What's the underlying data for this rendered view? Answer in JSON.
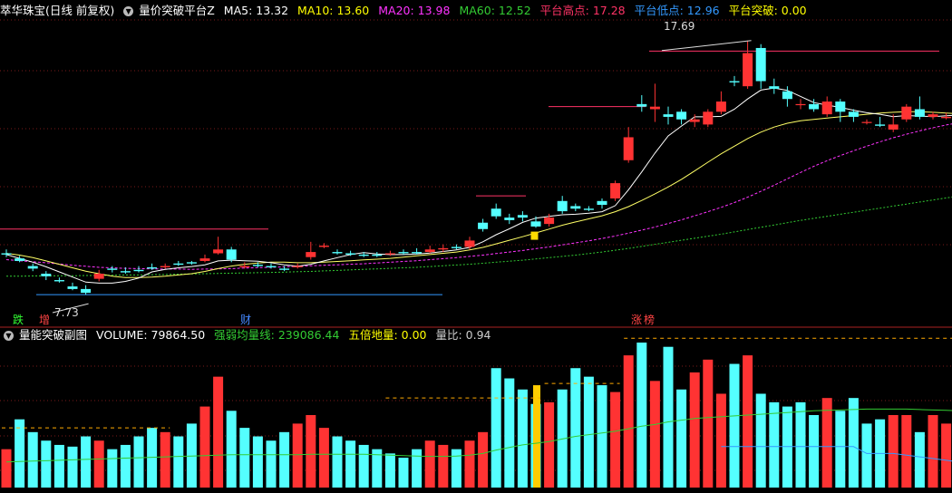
{
  "main_header": {
    "stock": "萃华珠宝(日线 前复权)",
    "indicator": "量价突破平台Z",
    "ma5": "MA5: 13.32",
    "ma10": "MA10: 13.60",
    "ma20": "MA20: 13.98",
    "ma60": "MA60: 12.52",
    "plat_high": "平台高点: 17.28",
    "plat_low": "平台低点: 12.96",
    "breakout": "平台突破: 0.00",
    "colors": {
      "ma5": "#ffffff",
      "ma10": "#ffff00",
      "ma20": "#ff33ff",
      "ma60": "#33cc33",
      "plat_high": "#ff3366",
      "plat_low": "#3399ff",
      "breakout": "#ffff00"
    }
  },
  "sub_header": {
    "indicator": "量能突破副图",
    "volume": "VOLUME: 79864.50",
    "strong_weak": "强弱均量线: 239086.44",
    "five_times": "五倍地量: 0.00",
    "ratio": "量比: 0.94"
  },
  "markers": {
    "max_label": "17.69",
    "min_label": "7.73",
    "die": "跌",
    "zeng": "增",
    "cai": "财",
    "zhang": "涨",
    "bang": "榜"
  },
  "chart_data": [
    {
      "type": "candlestick",
      "ylim": [
        7.2,
        18.5
      ],
      "grid": true,
      "platform_high_line": 17.28,
      "platform_low_line": 7.73,
      "early_platform_line": 10.3,
      "max_price": 17.69,
      "min_price": 7.73,
      "candles": [
        [
          9.35,
          9.3,
          9.5,
          9.2
        ],
        [
          9.15,
          9.05,
          9.25,
          9.0
        ],
        [
          8.85,
          8.75,
          8.95,
          8.65
        ],
        [
          8.55,
          8.45,
          8.65,
          8.3
        ],
        [
          8.3,
          8.25,
          8.4,
          8.2
        ],
        [
          8.05,
          7.95,
          8.2,
          7.9
        ],
        [
          7.95,
          7.8,
          8.1,
          7.73
        ],
        [
          8.35,
          8.55,
          8.7,
          8.25
        ],
        [
          8.75,
          8.7,
          8.85,
          8.6
        ],
        [
          8.65,
          8.6,
          8.8,
          8.55
        ],
        [
          8.7,
          8.65,
          8.85,
          8.6
        ],
        [
          8.8,
          8.75,
          8.95,
          8.7
        ],
        [
          8.8,
          8.85,
          8.95,
          8.75
        ],
        [
          8.95,
          8.9,
          9.05,
          8.85
        ],
        [
          9.0,
          8.95,
          9.05,
          8.9
        ],
        [
          9.05,
          9.15,
          9.3,
          9.0
        ],
        [
          9.35,
          9.5,
          10.0,
          9.3
        ],
        [
          9.5,
          9.1,
          9.6,
          9.0
        ],
        [
          8.8,
          8.85,
          9.0,
          8.75
        ],
        [
          8.9,
          8.85,
          9.0,
          8.8
        ],
        [
          8.85,
          8.8,
          8.95,
          8.75
        ],
        [
          8.75,
          8.7,
          8.85,
          8.65
        ],
        [
          8.8,
          8.85,
          8.95,
          8.75
        ],
        [
          9.2,
          9.4,
          9.8,
          9.1
        ],
        [
          9.6,
          9.65,
          9.75,
          9.55
        ],
        [
          9.4,
          9.35,
          9.5,
          9.3
        ],
        [
          9.35,
          9.3,
          9.45,
          9.25
        ],
        [
          9.3,
          9.25,
          9.4,
          9.2
        ],
        [
          9.3,
          9.25,
          9.4,
          9.2
        ],
        [
          9.35,
          9.35,
          9.45,
          9.25
        ],
        [
          9.4,
          9.35,
          9.5,
          9.3
        ],
        [
          9.4,
          9.35,
          9.55,
          9.3
        ],
        [
          9.4,
          9.5,
          9.65,
          9.35
        ],
        [
          9.5,
          9.55,
          9.7,
          9.4
        ],
        [
          9.6,
          9.55,
          9.7,
          9.5
        ],
        [
          9.6,
          9.85,
          10.0,
          9.5
        ],
        [
          10.55,
          10.3,
          10.7,
          10.2
        ],
        [
          11.1,
          10.8,
          11.3,
          10.7
        ],
        [
          10.75,
          10.65,
          10.9,
          10.5
        ],
        [
          10.85,
          10.75,
          11.0,
          10.6
        ],
        [
          10.6,
          10.4,
          10.8,
          10.35
        ],
        [
          10.5,
          10.75,
          10.9,
          10.4
        ],
        [
          11.4,
          11.0,
          11.6,
          10.9
        ],
        [
          11.2,
          11.1,
          11.3,
          11.0
        ],
        [
          11.1,
          11.05,
          11.2,
          11.0
        ],
        [
          11.4,
          11.25,
          11.5,
          11.1
        ],
        [
          11.5,
          12.1,
          12.2,
          11.4
        ],
        [
          13.0,
          13.9,
          14.3,
          12.9
        ],
        [
          15.2,
          15.1,
          15.55,
          14.9
        ],
        [
          15.0,
          15.1,
          16.0,
          14.5
        ],
        [
          14.8,
          14.7,
          15.1,
          14.4
        ],
        [
          14.9,
          14.6,
          15.0,
          14.4
        ],
        [
          14.5,
          14.6,
          14.8,
          14.3
        ],
        [
          14.4,
          14.9,
          15.0,
          14.3
        ],
        [
          14.9,
          15.3,
          15.7,
          14.8
        ],
        [
          16.1,
          16.05,
          16.3,
          15.9
        ],
        [
          15.9,
          17.2,
          17.69,
          15.8
        ],
        [
          17.4,
          16.1,
          17.55,
          15.8
        ],
        [
          15.9,
          15.8,
          16.2,
          15.6
        ],
        [
          15.7,
          15.4,
          15.9,
          15.1
        ],
        [
          15.2,
          15.2,
          15.4,
          15.0
        ],
        [
          15.2,
          15.0,
          15.4,
          14.9
        ],
        [
          14.8,
          15.3,
          15.5,
          14.7
        ],
        [
          15.3,
          14.9,
          15.4,
          14.5
        ],
        [
          14.9,
          14.7,
          15.0,
          14.5
        ],
        [
          14.5,
          14.5,
          14.6,
          14.4
        ],
        [
          14.4,
          14.35,
          14.7,
          14.3
        ],
        [
          14.2,
          14.4,
          14.8,
          14.1
        ],
        [
          14.6,
          15.1,
          15.2,
          14.5
        ],
        [
          15.0,
          14.7,
          15.5,
          14.6
        ],
        [
          14.7,
          14.8,
          14.9,
          14.6
        ],
        [
          14.65,
          14.7,
          14.85,
          14.6
        ],
        [
          14.75,
          14.6,
          14.8,
          14.5
        ],
        [
          14.6,
          14.3,
          14.7,
          14.2
        ],
        [
          14.2,
          14.25,
          14.35,
          14.1
        ],
        [
          14.3,
          14.4,
          14.5,
          14.2
        ],
        [
          14.25,
          14.15,
          14.3,
          14.1
        ],
        [
          14.15,
          14.05,
          14.2,
          13.95
        ],
        [
          13.95,
          14.0,
          14.05,
          13.9
        ],
        [
          14.0,
          14.05,
          14.1,
          13.95
        ],
        [
          14.05,
          13.6,
          14.1,
          13.55
        ],
        [
          13.4,
          13.65,
          13.75,
          13.35
        ],
        [
          13.6,
          13.55,
          13.65,
          13.5
        ]
      ],
      "ma5": [
        9.3,
        9.15,
        9.0,
        8.82,
        8.62,
        8.42,
        8.22,
        8.18,
        8.18,
        8.25,
        8.38,
        8.62,
        8.72,
        8.78,
        8.83,
        8.9,
        9.05,
        9.08,
        9.06,
        9.04,
        8.98,
        8.9,
        8.84,
        8.92,
        9.05,
        9.18,
        9.3,
        9.38,
        9.32,
        9.3,
        9.3,
        9.32,
        9.36,
        9.42,
        9.48,
        9.58,
        9.8,
        10.08,
        10.31,
        10.56,
        10.73,
        10.8,
        10.86,
        10.88,
        10.92,
        10.98,
        11.22,
        11.84,
        12.54,
        13.28,
        13.95,
        14.34,
        14.7,
        14.7,
        14.72,
        15.0,
        15.4,
        15.75,
        15.83,
        15.74,
        15.5,
        15.26,
        15.16,
        15.07,
        14.96,
        14.86,
        14.8,
        14.71,
        14.75,
        14.73,
        14.71,
        14.74,
        14.78,
        14.69,
        14.56,
        14.43,
        14.32,
        14.25,
        14.16,
        14.12,
        14.03,
        13.88,
        13.76
      ],
      "ma10": [
        9.35,
        9.28,
        9.18,
        9.05,
        8.92,
        8.78,
        8.65,
        8.55,
        8.45,
        8.4,
        8.4,
        8.42,
        8.45,
        8.5,
        8.55,
        8.64,
        8.75,
        8.85,
        8.92,
        8.97,
        9.0,
        9.0,
        8.98,
        8.98,
        9.0,
        9.03,
        9.06,
        9.09,
        9.12,
        9.15,
        9.2,
        9.25,
        9.3,
        9.35,
        9.4,
        9.48,
        9.58,
        9.72,
        9.86,
        10.0,
        10.15,
        10.3,
        10.45,
        10.58,
        10.7,
        10.82,
        10.98,
        11.18,
        11.42,
        11.68,
        11.95,
        12.25,
        12.58,
        12.92,
        13.25,
        13.55,
        13.85,
        14.1,
        14.3,
        14.45,
        14.55,
        14.6,
        14.65,
        14.7,
        14.75,
        14.8,
        14.85,
        14.88,
        14.9,
        14.9,
        14.88,
        14.85,
        14.82,
        14.79,
        14.76,
        14.7,
        14.64,
        14.58,
        14.5,
        14.42,
        14.33,
        14.25,
        14.16
      ],
      "ma20": [
        9.1,
        9.06,
        9.02,
        8.98,
        8.93,
        8.88,
        8.84,
        8.8,
        8.78,
        8.76,
        8.75,
        8.74,
        8.73,
        8.73,
        8.72,
        8.73,
        8.74,
        8.75,
        8.77,
        8.79,
        8.8,
        8.82,
        8.84,
        8.86,
        8.88,
        8.9,
        8.92,
        8.94,
        8.97,
        9.0,
        9.03,
        9.06,
        9.1,
        9.14,
        9.18,
        9.23,
        9.28,
        9.34,
        9.4,
        9.46,
        9.53,
        9.6,
        9.68,
        9.76,
        9.84,
        9.93,
        10.03,
        10.14,
        10.26,
        10.38,
        10.52,
        10.66,
        10.82,
        10.98,
        11.15,
        11.34,
        11.55,
        11.78,
        12.02,
        12.27,
        12.52,
        12.76,
        12.98,
        13.18,
        13.37,
        13.55,
        13.72,
        13.88,
        14.02,
        14.15,
        14.27,
        14.38,
        14.47,
        14.55,
        14.62,
        14.67,
        14.7,
        14.71,
        14.7,
        14.66,
        14.6,
        14.52,
        14.42
      ],
      "ma60": [
        8.45,
        8.45,
        8.46,
        8.46,
        8.47,
        8.47,
        8.48,
        8.48,
        8.49,
        8.5,
        8.5,
        8.51,
        8.52,
        8.53,
        8.54,
        8.55,
        8.56,
        8.57,
        8.58,
        8.59,
        8.6,
        8.61,
        8.63,
        8.64,
        8.66,
        8.68,
        8.7,
        8.72,
        8.74,
        8.76,
        8.78,
        8.8,
        8.83,
        8.86,
        8.89,
        8.92,
        8.96,
        9.0,
        9.04,
        9.08,
        9.13,
        9.18,
        9.23,
        9.28,
        9.34,
        9.4,
        9.47,
        9.54,
        9.62,
        9.7,
        9.78,
        9.86,
        9.94,
        10.02,
        10.1,
        10.19,
        10.28,
        10.37,
        10.46,
        10.55,
        10.64,
        10.72,
        10.8,
        10.88,
        10.96,
        11.04,
        11.12,
        11.2,
        11.28,
        11.36,
        11.44,
        11.52,
        11.6,
        11.68,
        11.76,
        11.84,
        11.92,
        12.0,
        12.08,
        12.16,
        12.24,
        12.34,
        12.44
      ]
    },
    {
      "type": "bar",
      "title": "量能突破副图",
      "ylim": [
        0,
        170000
      ],
      "volume": [
        45000,
        80000,
        65000,
        55000,
        50000,
        48000,
        60000,
        55000,
        45000,
        50000,
        60000,
        70000,
        65000,
        60000,
        75000,
        95000,
        130000,
        90000,
        70000,
        60000,
        55000,
        65000,
        75000,
        85000,
        70000,
        60000,
        55000,
        50000,
        45000,
        40000,
        35000,
        45000,
        55000,
        50000,
        45000,
        55000,
        65000,
        140000,
        128000,
        115000,
        98000,
        100000,
        115000,
        140000,
        130000,
        120000,
        112000,
        155000,
        170000,
        125000,
        165000,
        115000,
        135000,
        150000,
        110000,
        145000,
        155000,
        110000,
        100000,
        95000,
        100000,
        85000,
        105000,
        90000,
        105000,
        75000,
        80000,
        85000,
        85000,
        65000,
        85000,
        75000,
        70000,
        60000,
        55000,
        60000,
        55000,
        60000,
        60000,
        50000,
        60000,
        60000,
        55000
      ],
      "up": [
        true,
        false,
        false,
        false,
        false,
        false,
        false,
        true,
        false,
        false,
        false,
        false,
        true,
        false,
        false,
        true,
        true,
        false,
        false,
        false,
        false,
        false,
        true,
        true,
        true,
        false,
        false,
        false,
        false,
        false,
        false,
        false,
        true,
        true,
        false,
        true,
        false,
        false,
        false,
        false,
        false,
        true,
        false,
        false,
        false,
        false,
        true,
        true,
        false,
        true,
        false,
        false,
        true,
        true,
        true,
        false,
        true,
        false,
        false,
        false,
        false,
        false,
        true,
        false,
        false,
        false,
        false,
        true,
        true,
        false,
        true,
        true,
        false,
        false,
        true,
        true,
        false,
        false,
        true,
        true,
        false,
        true,
        false
      ],
      "strong_weak_line": [
        30000,
        30500,
        31000,
        31500,
        32000,
        32500,
        33000,
        33500,
        34000,
        34500,
        35000,
        35500,
        36000,
        36500,
        37000,
        37500,
        38000,
        38500,
        38500,
        38500,
        38500,
        38500,
        38500,
        39000,
        39000,
        39000,
        39000,
        39000,
        38500,
        38000,
        37500,
        37000,
        36500,
        36500,
        37000,
        38000,
        40000,
        44000,
        47000,
        50000,
        52000,
        54000,
        57000,
        60000,
        62000,
        64000,
        66000,
        69000,
        72000,
        74000,
        77000,
        79000,
        81000,
        82000,
        83000,
        84000,
        85000,
        86000,
        87000,
        88000,
        89000,
        90000,
        90500,
        91000,
        91500,
        92000,
        92000,
        92000,
        92000,
        91500,
        91000,
        90500,
        90000,
        89000,
        88000,
        87000,
        86000,
        85000,
        84000,
        83000,
        82000,
        81000,
        80000
      ],
      "blue_line_start_index": 54,
      "blue_line": [
        48000,
        48000,
        48000,
        48000,
        48000,
        48000,
        48000,
        48000,
        48000,
        48000,
        48000,
        40000,
        40000,
        40000,
        38000,
        36000,
        34000,
        32000,
        30000,
        30000,
        30000,
        30000,
        30000,
        30000,
        30000,
        30000,
        30000,
        30000,
        30000
      ],
      "dash_levels": [
        {
          "from": 0,
          "to": 12,
          "value": 70000
        },
        {
          "from": 29,
          "to": 40,
          "value": 105000
        },
        {
          "from": 41,
          "to": 46,
          "value": 122000
        },
        {
          "from": 47,
          "to": 82,
          "value": 175000
        }
      ],
      "highlight_index": 36
    }
  ]
}
